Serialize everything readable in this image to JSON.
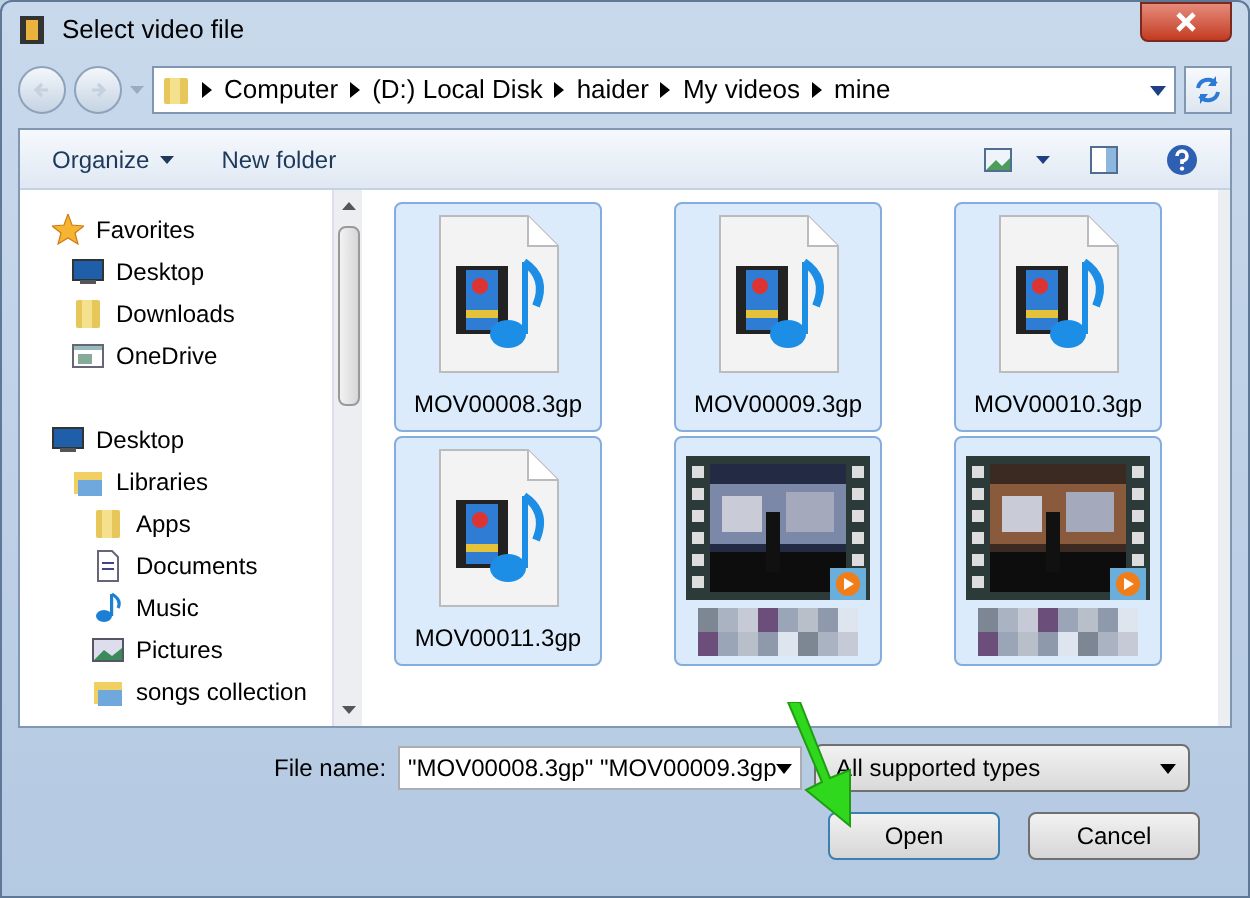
{
  "window": {
    "title": "Select video file"
  },
  "address_bar": {
    "segments": [
      "Computer",
      "(D:) Local Disk",
      "haider",
      "My videos",
      "mine"
    ]
  },
  "toolbar": {
    "buttons": [
      "Organize",
      "New folder"
    ]
  },
  "sidebar": {
    "items": [
      {
        "label": "Favorites",
        "kind": "favorites",
        "children": [
          {
            "label": "Desktop",
            "kind": "desktop"
          },
          {
            "label": "Downloads",
            "kind": "folder"
          },
          {
            "label": "OneDrive",
            "kind": "cloud"
          }
        ]
      },
      {
        "label": "Desktop",
        "kind": "desktop",
        "children": [
          {
            "label": "Libraries",
            "kind": "library",
            "children": [
              {
                "label": "Apps",
                "kind": "folder"
              },
              {
                "label": "Documents",
                "kind": "documents"
              },
              {
                "label": "Music",
                "kind": "music"
              },
              {
                "label": "Pictures",
                "kind": "pictures"
              },
              {
                "label": "songs collection",
                "kind": "library"
              }
            ]
          }
        ]
      }
    ]
  },
  "files": [
    {
      "kind": "audio-video",
      "name": "MOV00008.3gp",
      "selected": true
    },
    {
      "kind": "audio-video",
      "name": "MOV00009.3gp",
      "selected": true
    },
    {
      "kind": "audio-video",
      "name": "MOV00010.3gp",
      "selected": true
    },
    {
      "kind": "audio-video",
      "name": "MOV00011.3gp",
      "selected": true
    },
    {
      "kind": "video",
      "selected": true
    },
    {
      "kind": "video",
      "selected": true
    }
  ],
  "file_name": {
    "label": "File name:",
    "value": "\"MOV00008.3gp\" \"MOV00009.3gp"
  },
  "file_type": {
    "value": "All supported types"
  },
  "buttons": [
    "Open",
    "Cancel"
  ]
}
